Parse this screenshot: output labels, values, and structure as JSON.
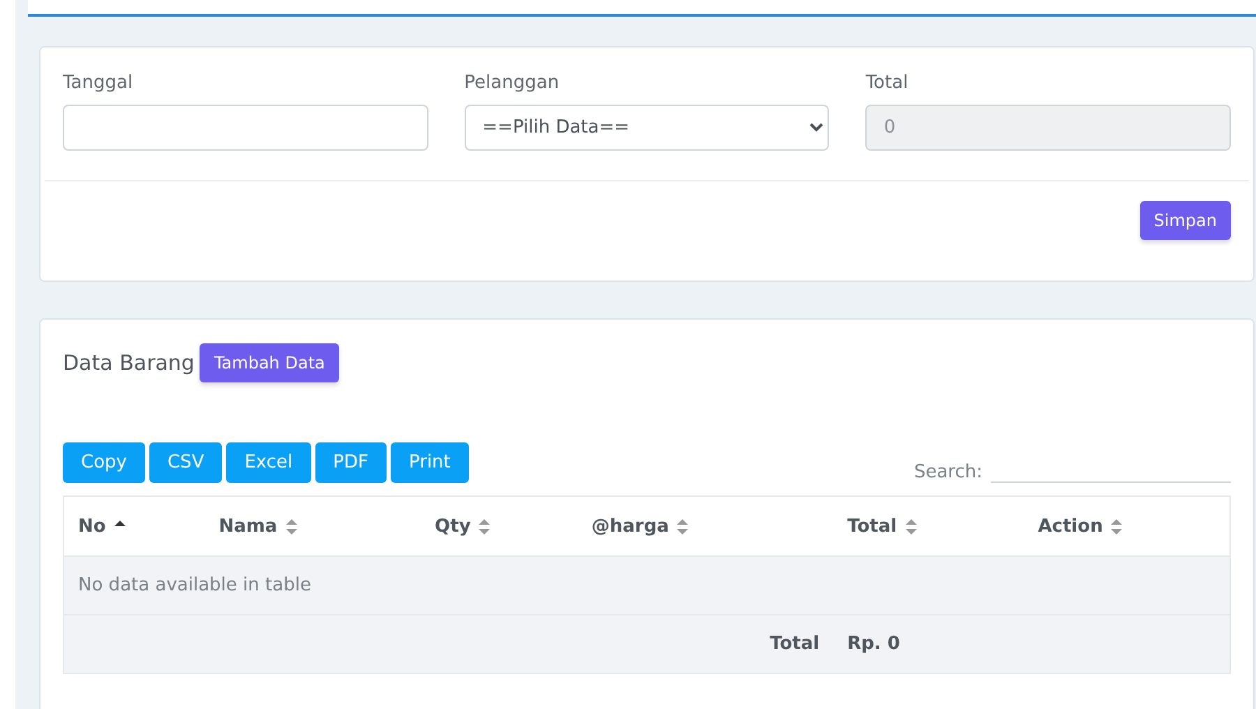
{
  "form": {
    "fields": [
      {
        "label": "Tanggal",
        "kind": "text",
        "disabled": false
      },
      {
        "label": "Pelanggan",
        "kind": "select",
        "value": "==Pilih Data==",
        "disabled": false
      },
      {
        "label": "Total",
        "kind": "text",
        "value": "0",
        "disabled": true
      }
    ],
    "submit": "Simpan"
  },
  "items": {
    "title": "Data Barang",
    "add_button": "Tambah Data",
    "export_buttons": [
      "Copy",
      "CSV",
      "Excel",
      "PDF",
      "Print"
    ],
    "search": {
      "label": "Search:"
    },
    "table": {
      "columns": [
        {
          "label": "No",
          "sorted": true
        },
        {
          "label": "Nama",
          "sorted": false
        },
        {
          "label": "Qty",
          "sorted": false
        },
        {
          "label": "@harga",
          "sorted": false
        },
        {
          "label": "Total",
          "sorted": false
        },
        {
          "label": "Action",
          "sorted": false
        }
      ],
      "empty_message": "No data available in table",
      "footer": {
        "label": "Total",
        "value": "Rp. 0"
      }
    }
  }
}
